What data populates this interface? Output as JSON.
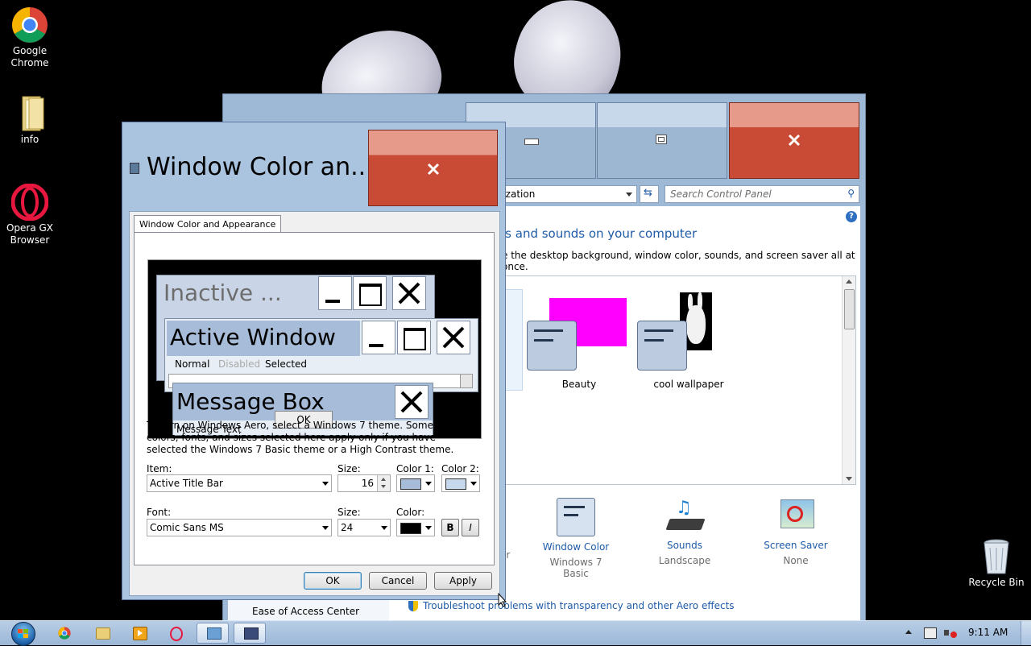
{
  "desktop": {
    "icons": [
      {
        "label": "Google\nChrome"
      },
      {
        "label": "info"
      },
      {
        "label": "Opera GX\nBrowser"
      },
      {
        "label": "Recycle Bin"
      }
    ]
  },
  "control_panel": {
    "address_tail": "lization",
    "search_placeholder": "Search Control Panel",
    "heading": "ls and sounds on your computer",
    "subheading": "e the desktop background, window color, sounds, and screen saver all at once.",
    "themes": [
      {
        "name": "Beauty"
      },
      {
        "name": "cool wallpaper"
      }
    ],
    "bottom_items": [
      {
        "title": "Window Color",
        "value": "Windows 7 Basic"
      },
      {
        "title": "Sounds",
        "value": "Landscape"
      },
      {
        "title": "Screen Saver",
        "value": "None"
      }
    ],
    "partial_left_title": "l",
    "partial_left_value": "er",
    "ease_of_access": "Ease of Access Center",
    "troubleshoot_link": "Troubleshoot problems with transparency and other Aero effects"
  },
  "dialog": {
    "title": "Window Color an...",
    "tab": "Window Color and Appearance",
    "preview": {
      "inactive_title": "Inactive ...",
      "active_title": "Active Window",
      "menu": [
        "Normal",
        "Disabled",
        "Selected"
      ],
      "msgbox_title": "Message Box",
      "msgbox_text": "Message Text",
      "msgbox_ok": "OK"
    },
    "info_text": "To turn on Windows Aero, select a Windows 7 theme.  Some of the colors, fonts, and sizes selected here apply only if you have selected the Windows 7 Basic theme or a High Contrast theme.",
    "item_label": "Item:",
    "item_value": "Active Title Bar",
    "size_label": "Size:",
    "size_value": "16",
    "color1_label": "Color 1:",
    "color2_label": "Color 2:",
    "font_label": "Font:",
    "font_value": "Comic Sans MS",
    "font_size_label": "Size:",
    "font_size_value": "24",
    "font_color_label": "Color:",
    "bold_label": "B",
    "italic_label": "I",
    "ok": "OK",
    "cancel": "Cancel",
    "apply": "Apply",
    "colors": {
      "color1": "#a6bcd9",
      "color2": "#c8d8ec",
      "font_color": "#000000"
    }
  },
  "taskbar": {
    "clock": "9:11 AM"
  },
  "colors": {
    "close_red": "#c94a35",
    "magenta": "#ff00ff",
    "link_blue": "#1e5ba8"
  }
}
